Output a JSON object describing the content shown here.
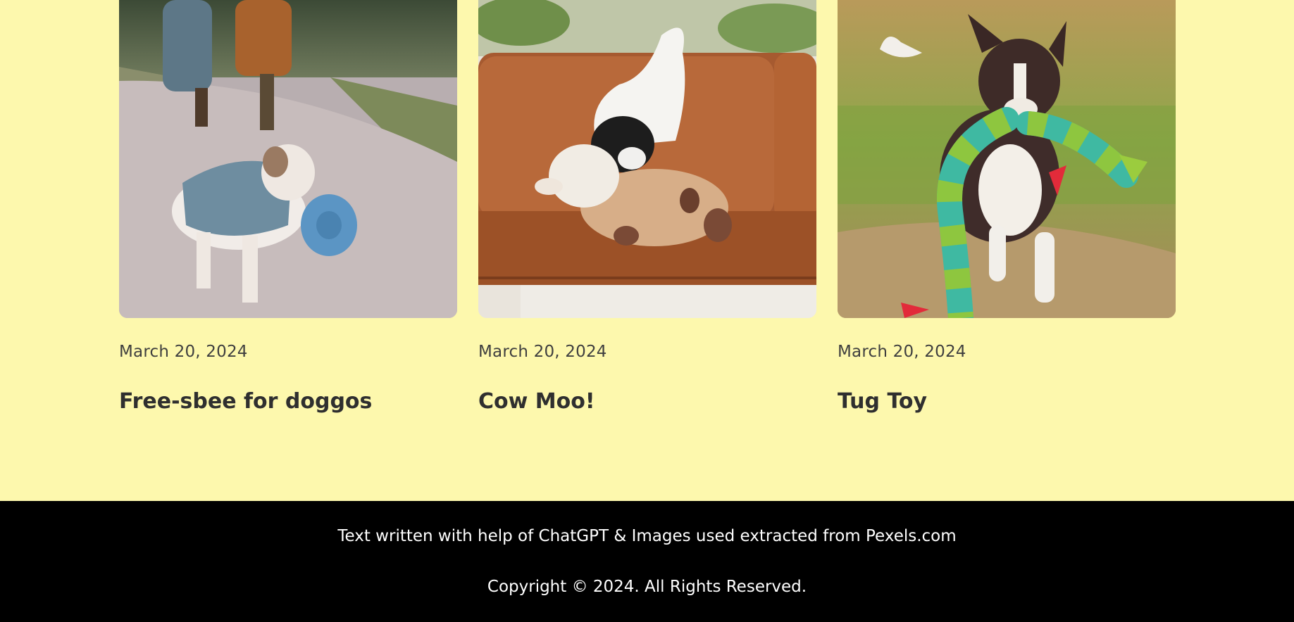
{
  "posts": [
    {
      "date": "March 20, 2024",
      "title": "Free-sbee for doggos",
      "image": "dog-with-frisbee-photo"
    },
    {
      "date": "March 20, 2024",
      "title": "Cow Moo!",
      "image": "dog-with-plush-cow-photo"
    },
    {
      "date": "March 20, 2024",
      "title": "Tug Toy",
      "image": "dog-with-tug-toy-photo"
    }
  ],
  "footer": {
    "credits": "Text written with help of ChatGPT & Images used extracted from Pexels.com",
    "copyright": "Copyright © 2024. All Rights Reserved."
  },
  "colors": {
    "page_background": "#fdf8ad",
    "footer_background": "#000000",
    "footer_text": "#ffffff",
    "title_text": "#2f2f2f",
    "date_text": "#3f3f3f"
  }
}
